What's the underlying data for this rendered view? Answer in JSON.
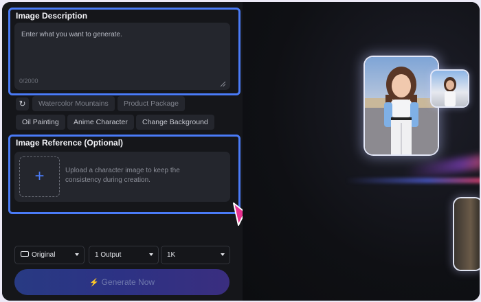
{
  "image_description": {
    "title": "Image Description",
    "placeholder": "Enter what you want to generate.",
    "char_count": "0/2000"
  },
  "prompt_chips": {
    "row1": [
      "Watercolor Mountains",
      "Product Package"
    ],
    "row2": [
      "Oil Painting",
      "Anime Character",
      "Change Background"
    ]
  },
  "image_reference": {
    "title": "Image Reference (Optional)",
    "plus": "+",
    "upload_hint": "Upload a character image to keep the consistency during creation."
  },
  "options": {
    "aspect": "Original",
    "outputs": "1 Output",
    "resolution": "1K"
  },
  "generate_label": "Generate Now",
  "colors": {
    "accent_border": "#4a7bf7",
    "cursor": "#e8318f",
    "panel_bg": "#15161a",
    "field_bg": "#24262d"
  },
  "icons": [
    "refresh-icon",
    "plus-icon",
    "resize-handle-icon",
    "frame-icon",
    "lightning-icon",
    "pointer-cursor-icon"
  ]
}
